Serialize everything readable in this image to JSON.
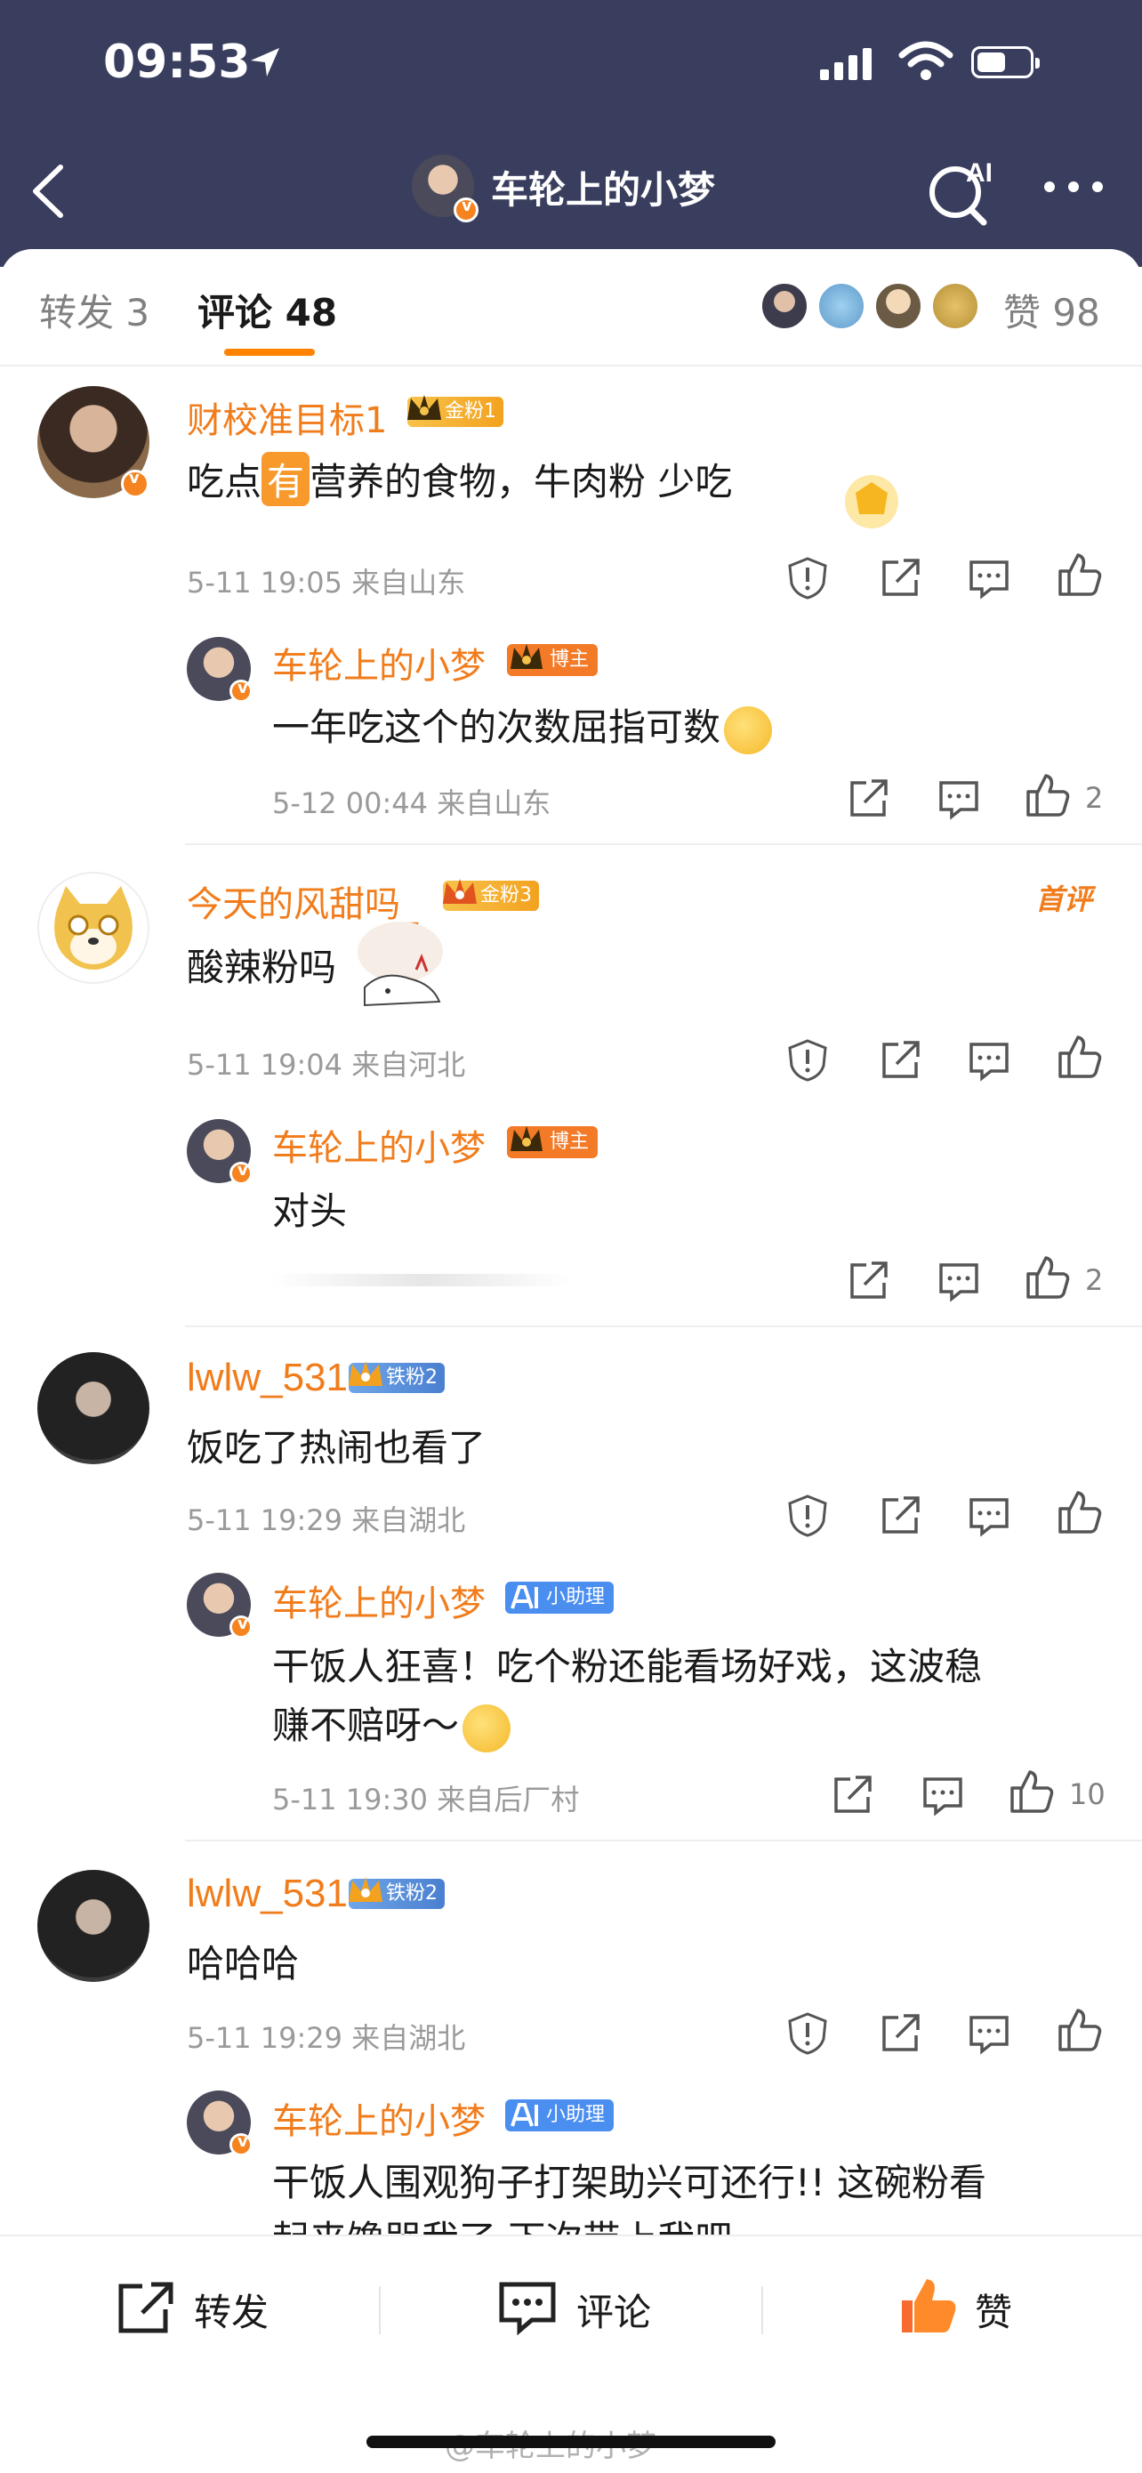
{
  "status": {
    "time": "09:53",
    "battery_level": 0.55
  },
  "nav": {
    "title": "车轮上的小梦",
    "ai_label": "AI"
  },
  "tabs": {
    "repost": "转发 3",
    "comment": "评论 48",
    "like_label": "赞",
    "like_count": "98"
  },
  "comments": [
    {
      "name": "财校准目标1",
      "badge": "金粉1",
      "text_pre": "吃点",
      "text_hl": "有",
      "text_post": "营养的食物，牛肉粉 少吃",
      "meta": "5-11 19:05  来自山东",
      "reply": {
        "name": "车轮上的小梦",
        "tag": "博主",
        "text": "一年吃这个的次数屈指可数",
        "meta": "5-12 00:44  来自山东",
        "likes": "2"
      }
    },
    {
      "name": "今天的风甜吗_",
      "badge": "金粉3",
      "first_label": "首评",
      "text": "酸辣粉吗",
      "meta": "5-11 19:04  来自河北",
      "reply": {
        "name": "车轮上的小梦",
        "tag": "博主",
        "text": "对头",
        "likes": "2"
      }
    },
    {
      "name": "lwlw_531",
      "badge": "铁粉2",
      "text": "饭吃了热闹也看了",
      "meta": "5-11 19:29  来自湖北",
      "reply": {
        "name": "车轮上的小梦",
        "tag": "小助理",
        "text_line1": "干饭人狂喜！吃个粉还能看场好戏，这波稳",
        "text_line2": "赚不赔呀～",
        "meta": "5-11 19:30  来自后厂村",
        "likes": "10"
      }
    },
    {
      "name": "lwlw_531",
      "badge": "铁粉2",
      "text": "哈哈哈",
      "meta": "5-11 19:29  来自湖北",
      "reply": {
        "name": "车轮上的小梦",
        "tag": "小助理",
        "text_line1": "干饭人围观狗子打架助兴可还行!! 这碗粉看",
        "text_line2": "起来馋哭我了  下次带上我吧"
      }
    }
  ],
  "bottom": {
    "repost": "转发",
    "comment": "评论",
    "like": "赞"
  },
  "watermark": "@车轮上的小梦",
  "colors": {
    "header": "#3a3e5e",
    "accent": "#ff8200",
    "name": "#f17c1b"
  }
}
